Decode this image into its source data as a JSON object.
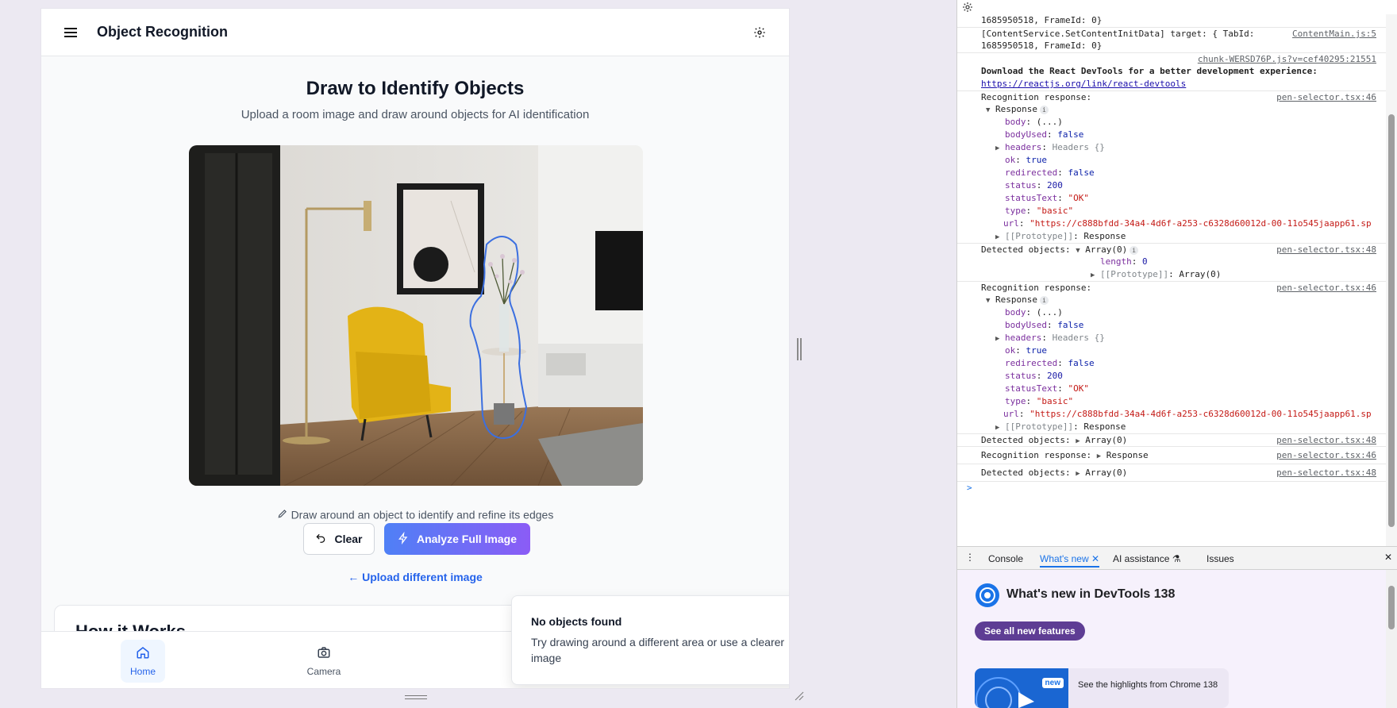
{
  "app": {
    "title": "Object Recognition",
    "heading": "Draw to Identify Objects",
    "subheading": "Upload a room image and draw around objects for AI identification",
    "hint": "Draw around an object to identify and refine its edges",
    "clear_label": "Clear",
    "analyze_label": "Analyze Full Image",
    "upload_link": "← Upload different image",
    "card_peek_title": "How it Works",
    "nav": [
      {
        "label": "Home",
        "icon": "home-icon",
        "active": true
      },
      {
        "label": "Camera",
        "icon": "camera-icon",
        "active": false
      }
    ],
    "toast": {
      "title": "No objects found",
      "description": "Try drawing around a different area or use a clearer image"
    },
    "colors": {
      "accent_start": "#4f80f6",
      "accent_end": "#8b5cf6",
      "link": "#2563eb",
      "selection_stroke": "#3b6fe0"
    }
  },
  "devtools": {
    "console": {
      "l01": "1685950518, FrameId: 0}",
      "l02": "[ContentService.SetContentInitData] target: { TabId:",
      "l02_src": "ContentMain.js:5",
      "l03": "1685950518, FrameId: 0}",
      "l04_src": "chunk-WERSD76P.js?v=cef40295:21551",
      "l05": "Download the React DevTools for a better development experience:",
      "l06": "https://reactjs.org/link/react-devtools",
      "r1": {
        "label": "Recognition response:",
        "src": "pen-selector.tsx:46",
        "obj": "Response",
        "body": "(...)",
        "bodyUsed": "false",
        "headers": "Headers {}",
        "ok": "true",
        "redirected": "false",
        "status": "200",
        "statusText": "\"OK\"",
        "type": "\"basic\"",
        "url": "\"https://c888bfdd-34a4-4d6f-a253-c6328d60012d-00-11o545jaapp61.sp",
        "proto": "Response"
      },
      "d1": {
        "label": "Detected objects:",
        "src": "pen-selector.tsx:48",
        "obj": "Array(0)",
        "length": "0",
        "proto": "Array(0)"
      },
      "r2": {
        "label": "Recognition response:",
        "src": "pen-selector.tsx:46",
        "obj": "Response",
        "body": "(...)",
        "bodyUsed": "false",
        "headers": "Headers {}",
        "ok": "true",
        "redirected": "false",
        "status": "200",
        "statusText": "\"OK\"",
        "type": "\"basic\"",
        "url": "\"https://c888bfdd-34a4-4d6f-a253-c6328d60012d-00-11o545jaapp61.sp",
        "proto": "Response"
      },
      "d2": {
        "label": "Detected objects:",
        "src": "pen-selector.tsx:48",
        "obj": "Array(0)"
      },
      "r3": {
        "label": "Recognition response:",
        "src": "pen-selector.tsx:46",
        "obj": "Response"
      },
      "d3": {
        "label": "Detected objects:",
        "src": "pen-selector.tsx:48",
        "obj": "Array(0)"
      },
      "prompt": ">"
    },
    "tabs": [
      "Console",
      "What's new",
      "AI assistance",
      "Issues"
    ],
    "active_tab": "What's new",
    "whats_new_title": "What's new in DevTools 138",
    "see_all": "See all new features",
    "card_badge": "new",
    "card_text": "See the highlights from Chrome 138"
  }
}
